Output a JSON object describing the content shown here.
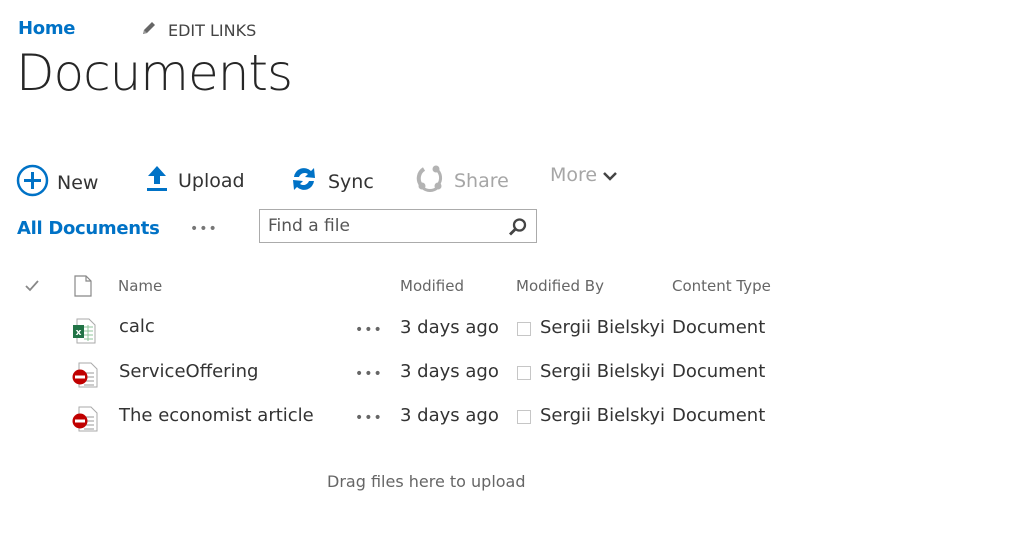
{
  "nav": {
    "home_label": "Home",
    "edit_links_label": "EDIT LINKS",
    "edit_icon": "pencil-icon"
  },
  "page": {
    "title": "Documents"
  },
  "toolbar": {
    "new_label": "New",
    "upload_label": "Upload",
    "sync_label": "Sync",
    "share_label": "Share",
    "more_label": "More",
    "icons": {
      "new": "plus-circle-icon",
      "upload": "upload-arrow-icon",
      "sync": "sync-icon",
      "share": "share-icon",
      "more": "chevron-down-icon"
    },
    "accent_color": "#0072c6",
    "disabled_color": "#a6a6a6"
  },
  "view": {
    "current_view": "All Documents",
    "more_views": "•••"
  },
  "search": {
    "placeholder": "Find a file",
    "value": "",
    "icon": "search-icon"
  },
  "table": {
    "columns": {
      "select_icon": "checkmark-icon",
      "type_icon": "document-icon",
      "name": "Name",
      "modified": "Modified",
      "modified_by": "Modified By",
      "content_type": "Content Type"
    },
    "rows": [
      {
        "icon": "excel-file-icon",
        "name": "calc",
        "menu": "•••",
        "modified": "3 days ago",
        "modified_by": "Sergii Bielskyi",
        "content_type": "Document"
      },
      {
        "icon": "blocked-file-icon",
        "name": "ServiceOffering",
        "menu": "•••",
        "modified": "3 days ago",
        "modified_by": "Sergii Bielskyi",
        "content_type": "Document"
      },
      {
        "icon": "blocked-file-icon",
        "name": "The economist article",
        "menu": "•••",
        "modified": "3 days ago",
        "modified_by": "Sergii Bielskyi",
        "content_type": "Document"
      }
    ]
  },
  "footer": {
    "drag_hint": "Drag files here to upload"
  }
}
